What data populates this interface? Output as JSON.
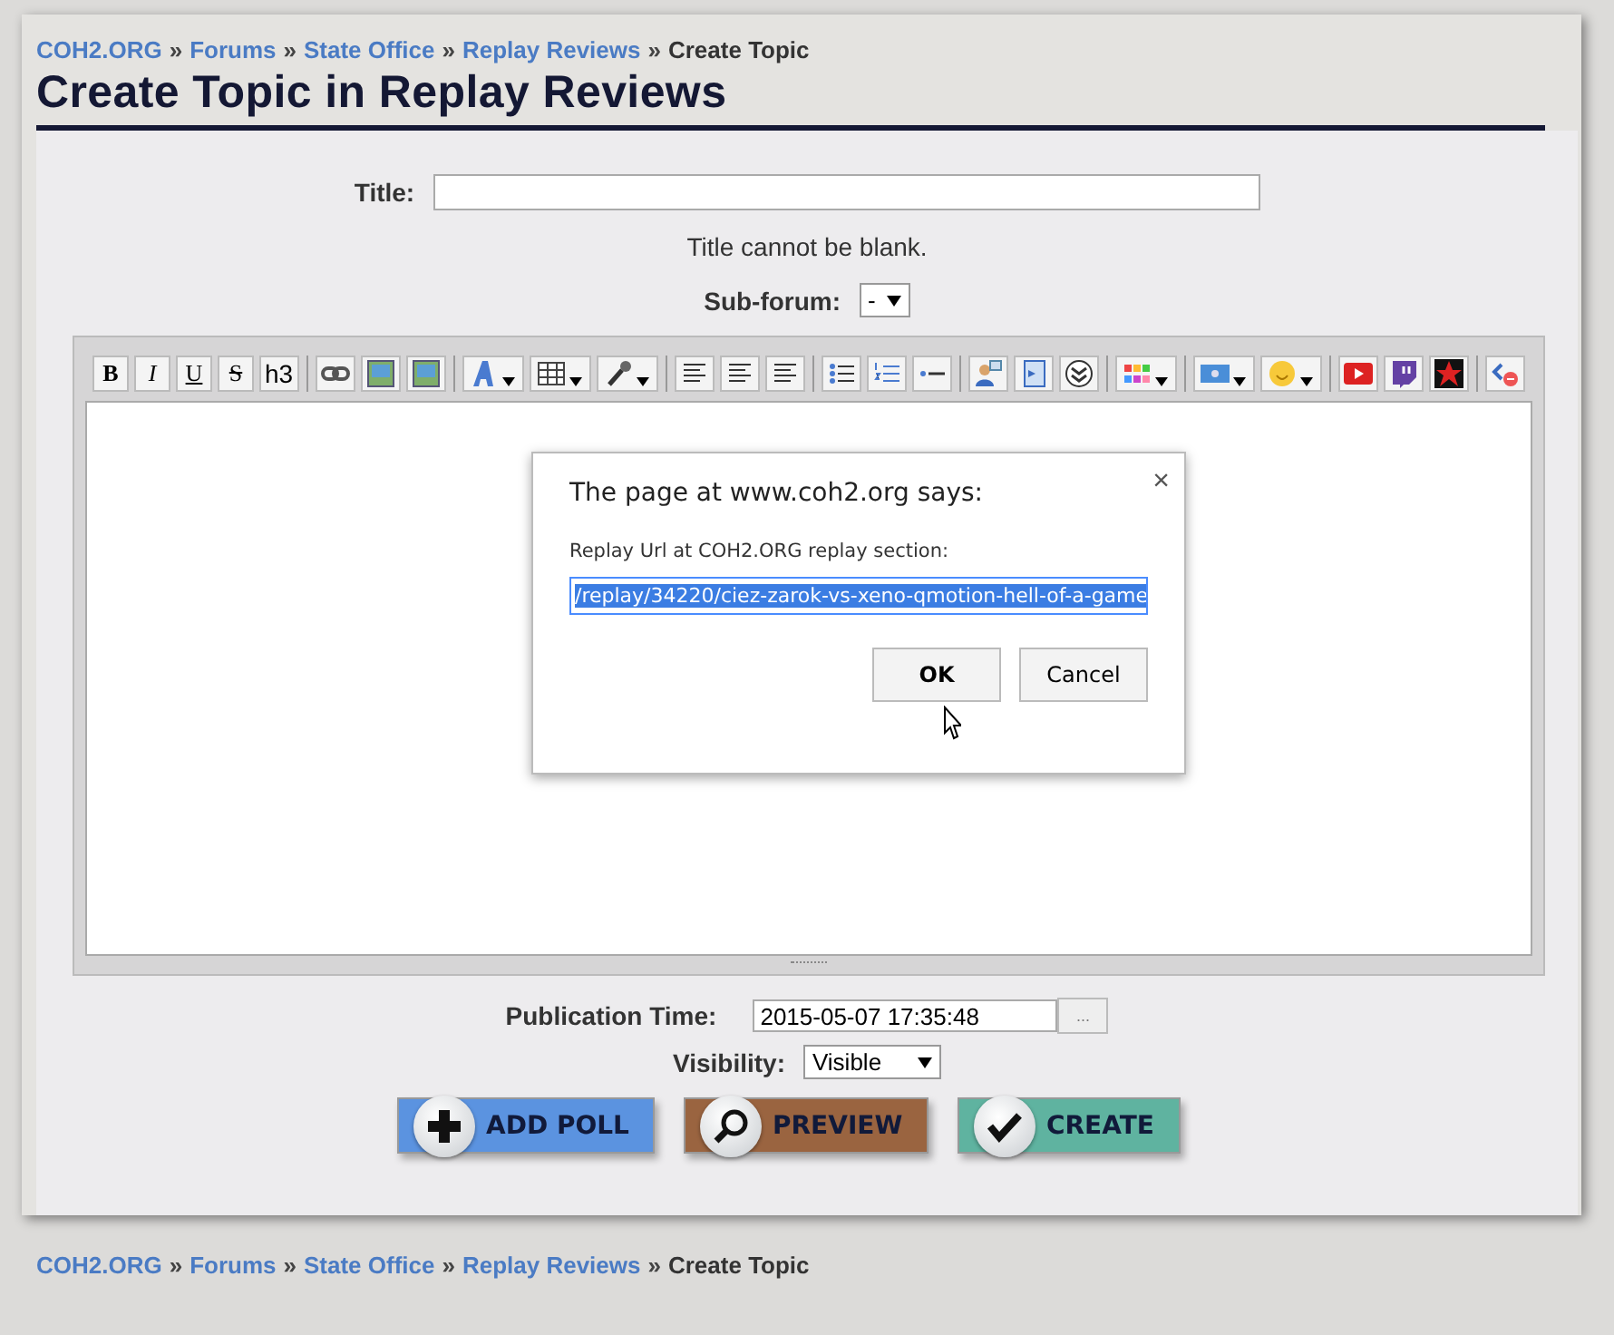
{
  "breadcrumb": [
    {
      "label": "COH2.ORG",
      "link": true
    },
    {
      "label": "Forums",
      "link": true
    },
    {
      "label": "State Office",
      "link": true
    },
    {
      "label": "Replay Reviews",
      "link": true
    },
    {
      "label": "Create Topic",
      "link": false
    }
  ],
  "separator": "»",
  "page_title": "Create Topic in Replay Reviews",
  "title_field": {
    "label": "Title:"
  },
  "error": "Title cannot be blank.",
  "subforum": {
    "label": "Sub-forum:",
    "value": "-"
  },
  "toolbar": [
    [
      {
        "kind": "text",
        "label": "B"
      },
      {
        "kind": "text",
        "label": "I"
      },
      {
        "kind": "text",
        "label": "U"
      },
      {
        "kind": "text",
        "label": "S"
      },
      {
        "kind": "text",
        "label": "h3"
      }
    ],
    [
      {
        "kind": "icon"
      },
      {
        "kind": "icon"
      },
      {
        "kind": "icon"
      }
    ],
    [
      {
        "kind": "menu"
      },
      {
        "kind": "menu"
      },
      {
        "kind": "menu"
      }
    ],
    [
      {
        "kind": "icon"
      },
      {
        "kind": "icon"
      },
      {
        "kind": "icon"
      }
    ],
    [
      {
        "kind": "icon"
      },
      {
        "kind": "icon"
      },
      {
        "kind": "icon"
      }
    ],
    [
      {
        "kind": "icon"
      },
      {
        "kind": "icon"
      },
      {
        "kind": "icon"
      }
    ],
    [
      {
        "kind": "menu"
      }
    ],
    [
      {
        "kind": "menu"
      },
      {
        "kind": "menu"
      }
    ],
    [
      {
        "kind": "icon"
      },
      {
        "kind": "icon"
      },
      {
        "kind": "icon"
      }
    ],
    [
      {
        "kind": "icon"
      }
    ]
  ],
  "dialog": {
    "title": "The page at www.coh2.org says:",
    "prompt": "Replay Url at COH2.ORG replay section:",
    "value": "/replay/34220/ciez-zarok-vs-xeno-qmotion-hell-of-a-game",
    "ok": "OK",
    "cancel": "Cancel",
    "close": "×"
  },
  "publication": {
    "label": "Publication Time:",
    "value": "2015-05-07 17:35:48",
    "picker": "..."
  },
  "visibility": {
    "label": "Visibility:",
    "value": "Visible"
  },
  "actions": [
    {
      "kind": "add",
      "label": "ADD POLL",
      "color": "#5b93e0"
    },
    {
      "kind": "preview",
      "label": "PREVIEW",
      "color": "#9a6440"
    },
    {
      "kind": "create",
      "label": "CREATE",
      "color": "#5fb3a0"
    }
  ],
  "footer_breadcrumb": [
    {
      "label": "COH2.ORG",
      "link": true
    },
    {
      "label": "Forums",
      "link": true
    },
    {
      "label": "State Office",
      "link": true
    },
    {
      "label": "Replay Reviews",
      "link": true
    },
    {
      "label": "Create Topic",
      "link": false
    }
  ]
}
